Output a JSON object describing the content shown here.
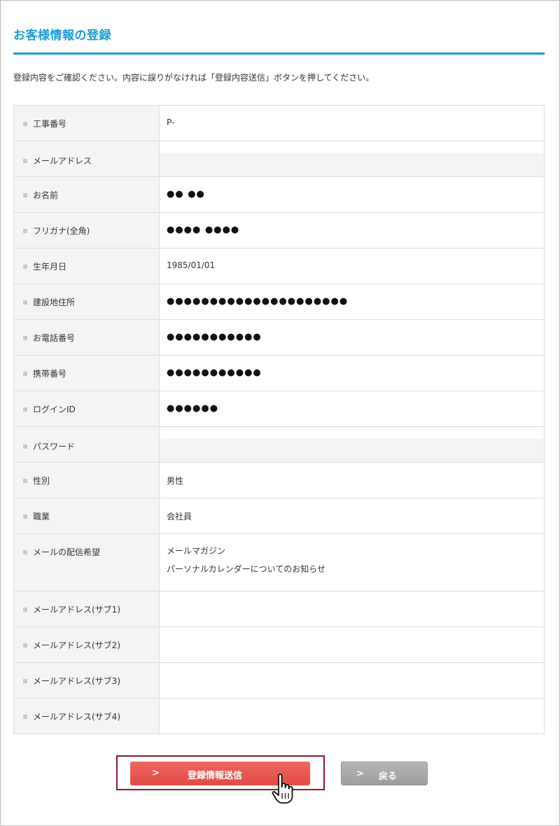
{
  "page": {
    "title": "お客様情報の登録",
    "instruction": "登録内容をご確認ください。内容に誤りがなければ「登録内容送信」ボタンを押してください。"
  },
  "rows": [
    {
      "label": "工事番号",
      "value": "P-"
    },
    {
      "label": "メールアドレス",
      "value": ""
    },
    {
      "label": "お名前",
      "value": "●● ●●"
    },
    {
      "label": "フリガナ(全角)",
      "value": "●●●● ●●●●"
    },
    {
      "label": "生年月日",
      "value": "1985/01/01"
    },
    {
      "label": "建設地住所",
      "value": "●●●●●●●●●●●●●●●●●●●●●"
    },
    {
      "label": "お電話番号",
      "value": "●●●●●●●●●●●"
    },
    {
      "label": "携帯番号",
      "value": "●●●●●●●●●●●"
    },
    {
      "label": "ログインID",
      "value": "●●●●●●"
    },
    {
      "label": "パスワード",
      "value": ""
    },
    {
      "label": "性別",
      "value": "男性"
    },
    {
      "label": "職業",
      "value": "会社員"
    },
    {
      "label": "メールの配信希望",
      "values": [
        "メールマガジン",
        "パーソナルカレンダーについてのお知らせ"
      ]
    },
    {
      "label": "メールアドレス(サブ1)",
      "value": ""
    },
    {
      "label": "メールアドレス(サブ2)",
      "value": ""
    },
    {
      "label": "メールアドレス(サブ3)",
      "value": ""
    },
    {
      "label": "メールアドレス(サブ4)",
      "value": ""
    }
  ],
  "buttons": {
    "submit_arrow": ">",
    "submit_label": "登録情報送信",
    "back_arrow": ">",
    "back_label": "戻る"
  },
  "colors": {
    "accent": "#1a9cd8",
    "submit": "#e8534d",
    "back": "#a8a8a8",
    "highlight": "#8b1a2b"
  },
  "icons": {
    "cursor": "hand-pointer-icon",
    "bullet": "square-bullet-icon"
  }
}
